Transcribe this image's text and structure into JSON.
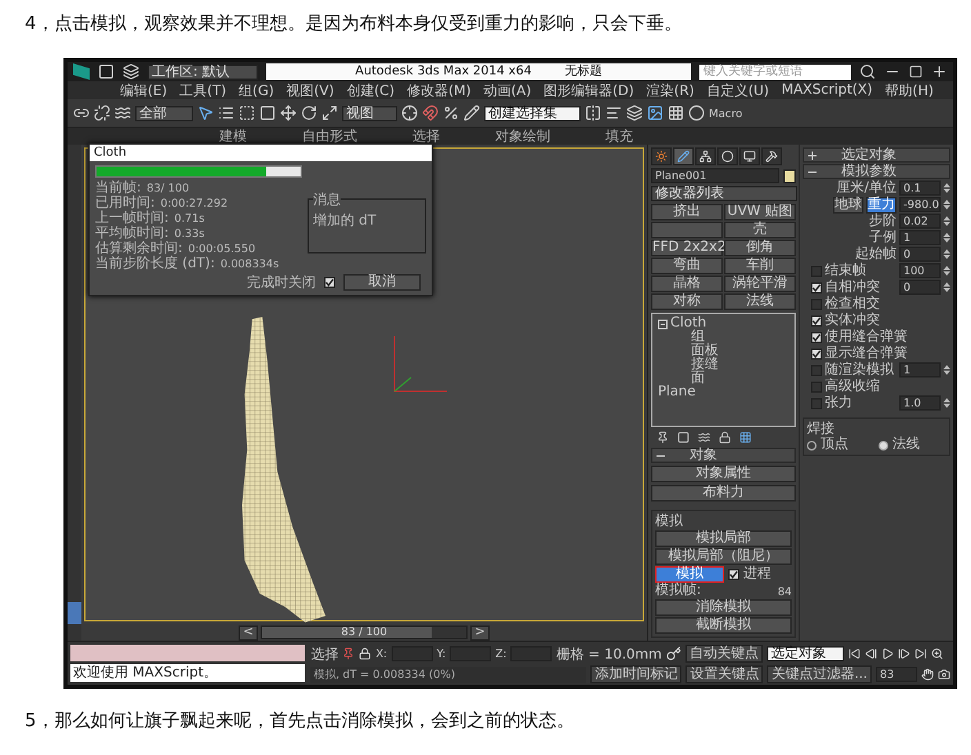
{
  "heading": "4，点击模拟，观察效果并不理想。是因为布料本身仅受到重力的影响，只会下垂。",
  "app": {
    "title_bar": {
      "workspace": "工作区: 默认",
      "app_name": "Autodesk 3ds Max  2014 x64",
      "document": "无标题",
      "search": {
        "placeholder": "键入关键字或短语"
      }
    },
    "menu": [
      "编辑(E)",
      "工具(T)",
      "组(G)",
      "视图(V)",
      "创建(C)",
      "修改器(M)",
      "动画(A)",
      "图形编辑器(D)",
      "渲染(R)",
      "自定义(U)",
      "MAXScript(X)",
      "帮助(H)"
    ],
    "toolbar": {
      "selection_filter": "全部",
      "reference_coord": "视图",
      "named_selection": "创建选择集",
      "macro": "Macro"
    },
    "ribbon_tabs": [
      "建模",
      "自由形式",
      "选择",
      "对象绘制",
      "填充"
    ],
    "cloth_dialog": {
      "title": "Cloth",
      "level": 0.83,
      "stats": [
        {
          "label": "当前帧:",
          "value": "83/ 100"
        },
        {
          "label": "已用时间:",
          "value": "0:00:27.292"
        },
        {
          "label": "上一帧时间:",
          "value": "0.71s"
        },
        {
          "label": "平均帧时间:",
          "value": "0.33s"
        },
        {
          "label": "估算剩余时间:",
          "value": "0:00:05.550"
        },
        {
          "label": "当前步阶长度 (dT):",
          "value": "0.008334s"
        }
      ],
      "message_title": "消息",
      "message": "增加的 dT",
      "close_label": "完成时关闭",
      "close_checked": true,
      "cancel": "取消"
    },
    "command_panel": {
      "tabs": [
        {
          "kind": "create",
          "selected": false
        },
        {
          "kind": "modify",
          "selected": true
        },
        {
          "kind": "hierarchy",
          "selected": false
        },
        {
          "kind": "motion",
          "selected": false
        },
        {
          "kind": "display",
          "selected": false
        },
        {
          "kind": "utilities",
          "selected": false
        }
      ],
      "object_name": "Plane001",
      "modifier_list": "修改器列表",
      "modifier_rows": [
        [
          "挤出",
          "UVW 贴图"
        ],
        [
          "壳"
        ],
        [
          "FFD 2x2x2",
          "倒角"
        ],
        [
          "弯曲",
          "车削"
        ],
        [
          "晶格",
          "涡轮平滑"
        ],
        [
          "对称",
          "法线"
        ]
      ],
      "stack": [
        {
          "label": "Cloth",
          "expanded": true,
          "children": [
            {
              "label": "组"
            },
            {
              "label": "面板"
            },
            {
              "label": "接缝"
            },
            {
              "label": "面"
            }
          ]
        },
        {
          "label": "Plane"
        }
      ],
      "rollouts": [
        {
          "title": "选定对象",
          "expanded": false
        },
        {
          "title": "模拟参数",
          "expanded": true
        }
      ],
      "params": [
        {
          "kind": "spinner",
          "label": "厘米/单位",
          "value": "0.1"
        },
        {
          "kind": "gravity",
          "button": "地球",
          "toggle": "重力",
          "on": true,
          "value": "-980.0"
        },
        {
          "kind": "spinner",
          "label": "步阶",
          "value": "0.02"
        },
        {
          "kind": "spinner",
          "label": "子例",
          "value": "1"
        },
        {
          "kind": "spinner",
          "label": "起始帧",
          "value": "0"
        },
        {
          "kind": "check_spinner",
          "label": "结束帧",
          "checked": false,
          "value": "100"
        },
        {
          "kind": "check_spinner",
          "label": "自相冲突",
          "checked": true,
          "value": "0"
        },
        {
          "kind": "check",
          "label": "检查相交",
          "checked": false
        },
        {
          "kind": "check",
          "label": "实体冲突",
          "checked": true
        },
        {
          "kind": "check",
          "label": "使用缝合弹簧",
          "checked": true
        },
        {
          "kind": "check",
          "label": "显示缝合弹簧",
          "checked": true
        },
        {
          "kind": "check_spinner",
          "label": "随渲染模拟",
          "checked": false,
          "value": "1"
        },
        {
          "kind": "check",
          "label": "高级收缩",
          "checked": false
        },
        {
          "kind": "check_spinner",
          "label": "张力",
          "checked": false,
          "value": "1.0"
        }
      ],
      "weld": {
        "title": "焊接",
        "options": [
          {
            "label": "顶点",
            "selected": false
          },
          {
            "label": "法线",
            "selected": true
          }
        ]
      },
      "object_rollout": {
        "title": "对象",
        "expanded": true,
        "buttons": [
          "对象属性",
          "布料力"
        ]
      },
      "simulation": {
        "title": "模拟",
        "local": "模拟局部",
        "local_damped": "模拟局部（阻尼）",
        "simulate": "模拟",
        "progress_label": "进程",
        "progress_checked": true,
        "frame_label": "模拟帧:",
        "frame": "84",
        "erase": "消除模拟",
        "truncate": "截断模拟"
      }
    },
    "timeline": {
      "prev": "<",
      "position": "83 / 100",
      "next": ">",
      "level": 0.83
    },
    "script_listener": {
      "output": "欢迎使用 MAXScript。"
    },
    "status": {
      "selection": "选择",
      "x": "X:",
      "y": "Y:",
      "z": "Z:",
      "grid": "栅格 = 10.0mm",
      "prompt": "模拟, dT = 0.008334 (0%)",
      "add_time_tag": "添加时间标记",
      "auto_key": "自动关键点",
      "set_key": "设置关键点",
      "key_mode": "选定对象",
      "key_filters": "关键点过滤器...",
      "frame": "83"
    }
  },
  "footer": "5，那么如何让旗子飘起来呢，首先点击消除模拟，会到之前的状态。"
}
